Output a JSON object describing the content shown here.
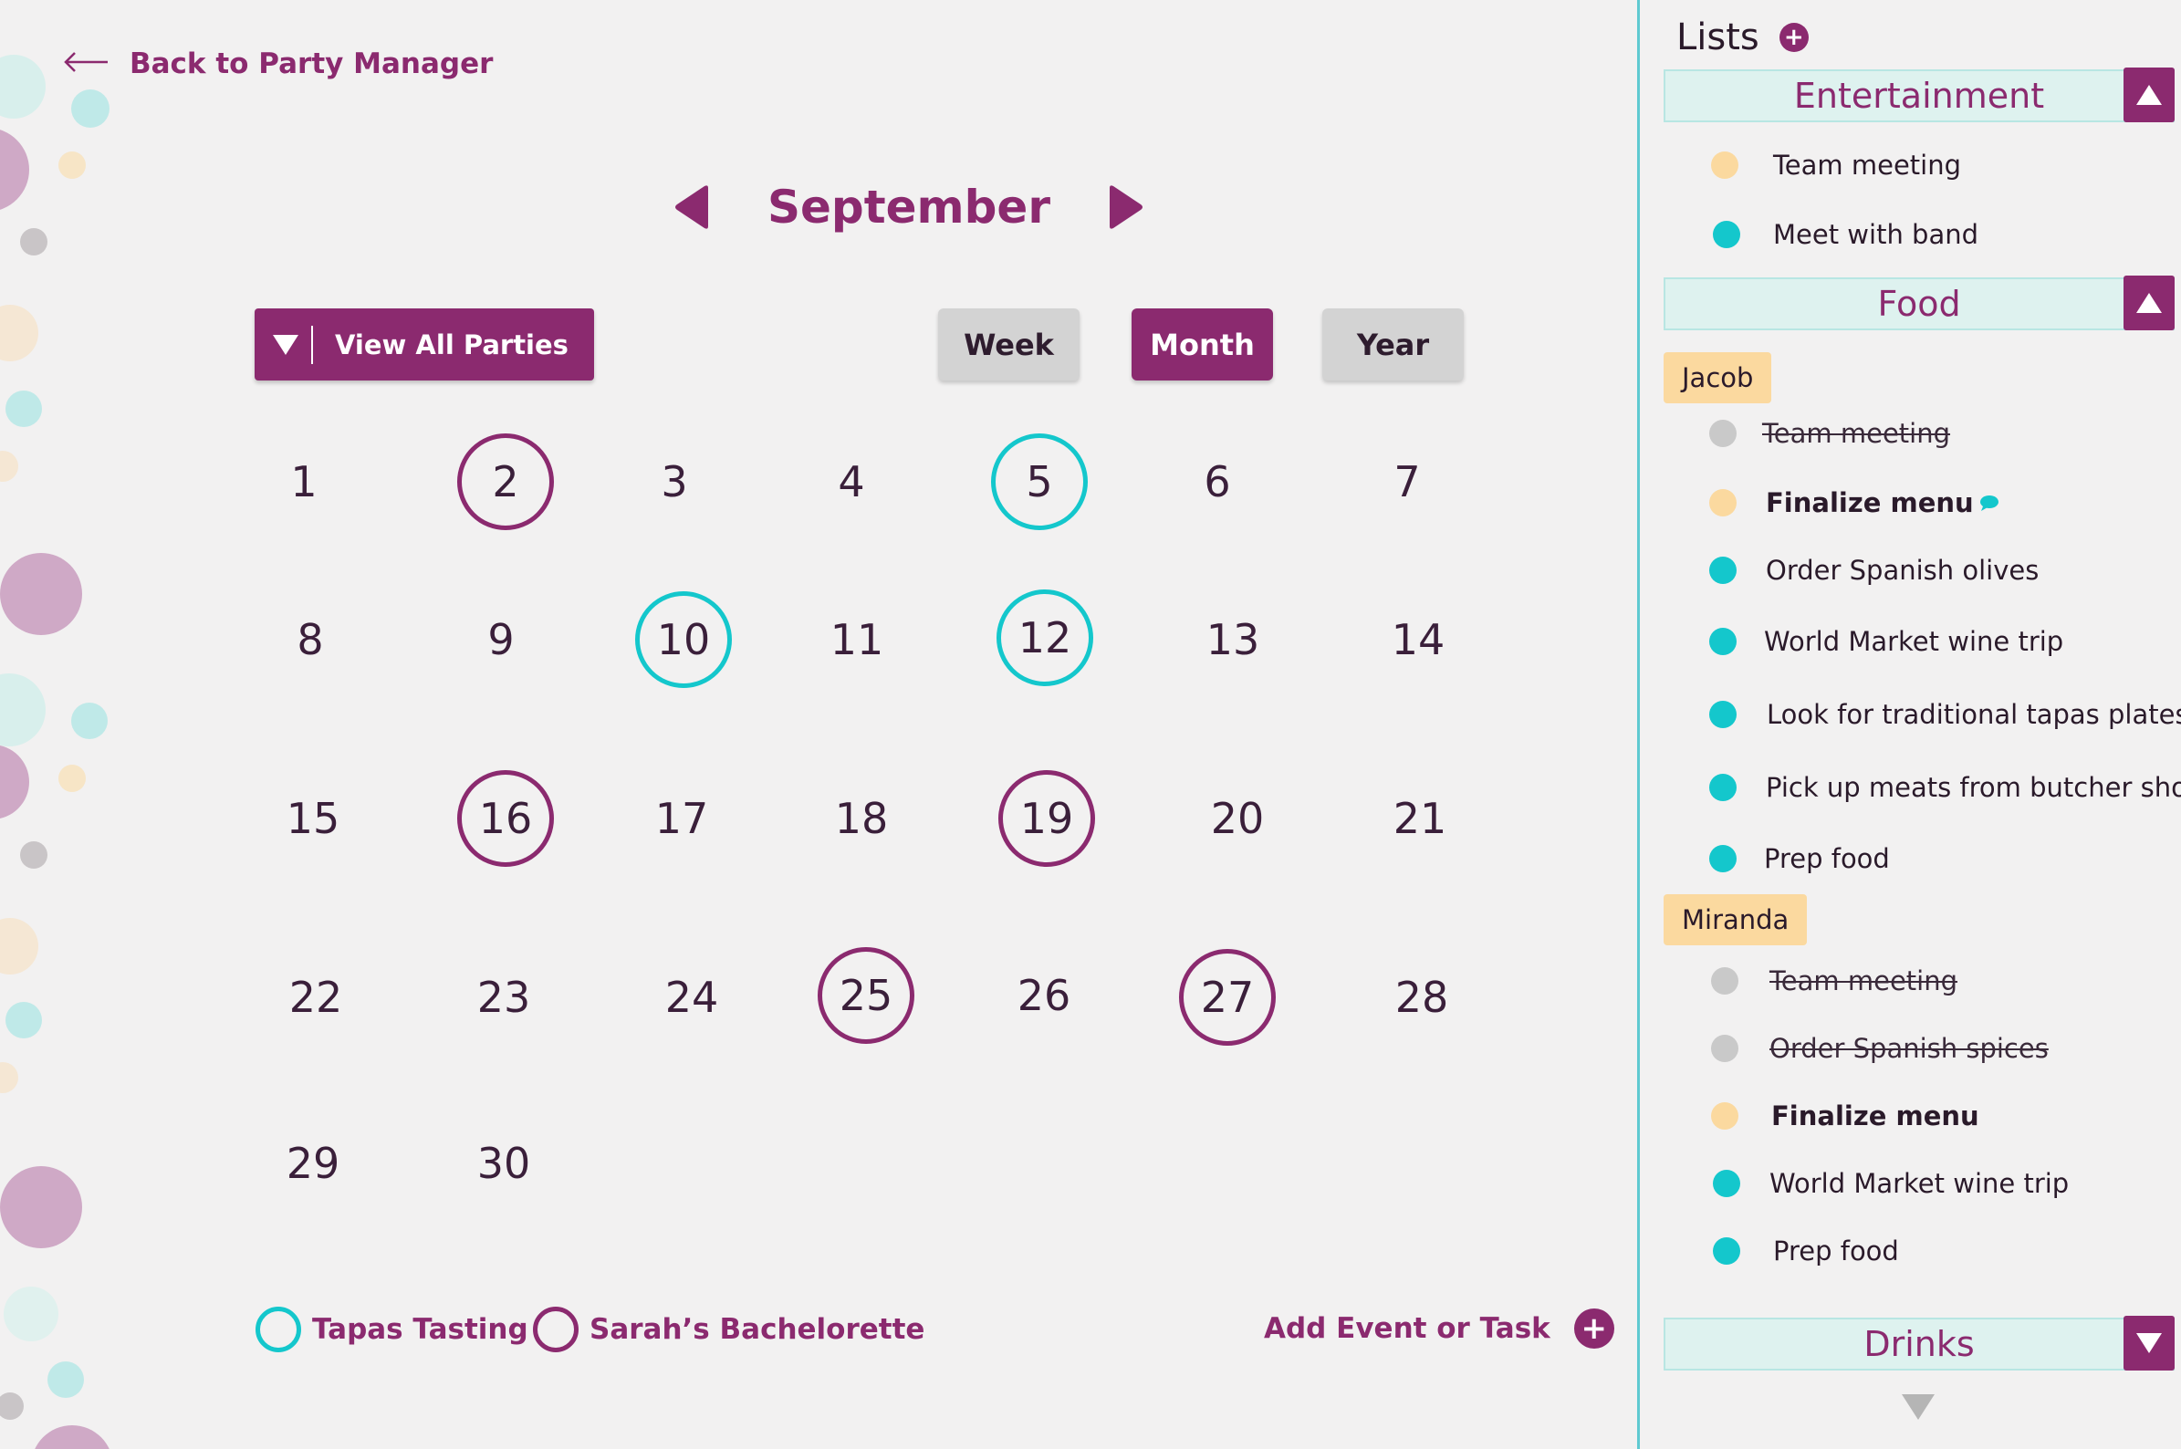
{
  "colors": {
    "brand_purple": "#8b2a6f",
    "teal": "#14c7cc",
    "peach": "#fbd99f",
    "grey": "#c9c9c9",
    "background": "#f2f1f1"
  },
  "nav": {
    "back_label": "Back to Party Manager"
  },
  "calendar": {
    "month": "September",
    "view_all_label": "View All Parties",
    "views": {
      "week": "Week",
      "month": "Month",
      "year": "Year",
      "selected": "Month"
    },
    "days": [
      "1",
      "2",
      "3",
      "4",
      "5",
      "6",
      "7",
      "8",
      "9",
      "10",
      "11",
      "12",
      "13",
      "14",
      "15",
      "16",
      "17",
      "18",
      "19",
      "20",
      "21",
      "22",
      "23",
      "24",
      "25",
      "26",
      "27",
      "28",
      "29",
      "30"
    ],
    "tapas_tasting_days": [
      "5",
      "10",
      "12"
    ],
    "bachelorette_days": [
      "2",
      "16",
      "19",
      "25",
      "27"
    ]
  },
  "legend": {
    "tapas": "Tapas Tasting",
    "bachelorette": "Sarah’s Bachelorette"
  },
  "actions": {
    "add_event_label": "Add Event or Task"
  },
  "lists": {
    "title": "Lists",
    "entertainment": {
      "title": "Entertainment",
      "tasks": [
        {
          "label": "Team meeting",
          "status": "peach"
        },
        {
          "label": "Meet  with band",
          "status": "teal"
        }
      ]
    },
    "food": {
      "title": "Food",
      "jacob": {
        "name": "Jacob",
        "tasks": [
          {
            "label": "Team meeting",
            "status": "done"
          },
          {
            "label": "Finalize menu",
            "status": "peach"
          },
          {
            "label": "Order Spanish olives",
            "status": "teal"
          },
          {
            "label": "World Market wine trip",
            "status": "teal"
          },
          {
            "label": "Look for traditional tapas plates",
            "status": "teal"
          },
          {
            "label": "Pick up meats from butcher shop",
            "status": "teal"
          },
          {
            "label": "Prep food",
            "status": "teal"
          }
        ]
      },
      "miranda": {
        "name": "Miranda",
        "tasks": [
          {
            "label": "Team meeting",
            "status": "done"
          },
          {
            "label": "Order Spanish spices",
            "status": "done"
          },
          {
            "label": "Finalize menu",
            "status": "peach"
          },
          {
            "label": "World Market wine trip",
            "status": "teal"
          },
          {
            "label": "Prep food",
            "status": "teal"
          }
        ]
      }
    },
    "drinks": {
      "title": "Drinks"
    }
  }
}
